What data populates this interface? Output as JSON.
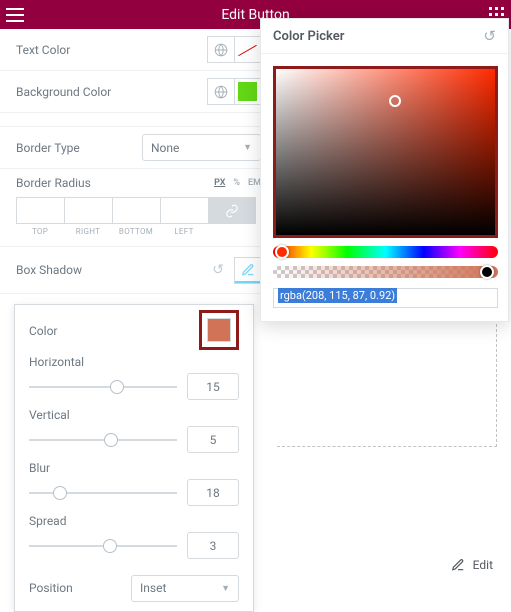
{
  "header": {
    "title": "Edit Button"
  },
  "textColor": {
    "label": "Text Color"
  },
  "bgColor": {
    "label": "Background Color"
  },
  "borderType": {
    "label": "Border Type",
    "value": "None"
  },
  "borderRadius": {
    "label": "Border Radius",
    "units": {
      "px": "PX",
      "pct": "%",
      "em": "EM"
    },
    "cols": {
      "top": "TOP",
      "right": "RIGHT",
      "bottom": "BOTTOM",
      "left": "LEFT"
    }
  },
  "boxShadow": {
    "label": "Box Shadow"
  },
  "shadow": {
    "colorLabel": "Color",
    "horizontal": {
      "label": "Horizontal",
      "value": "15"
    },
    "vertical": {
      "label": "Vertical",
      "value": "5"
    },
    "blur": {
      "label": "Blur",
      "value": "18"
    },
    "spread": {
      "label": "Spread",
      "value": "3"
    },
    "position": {
      "label": "Position",
      "value": "Inset"
    }
  },
  "picker": {
    "title": "Color Picker",
    "value": "rgba(208, 115, 87, 0.92)"
  },
  "editChip": {
    "label": "Edit"
  }
}
